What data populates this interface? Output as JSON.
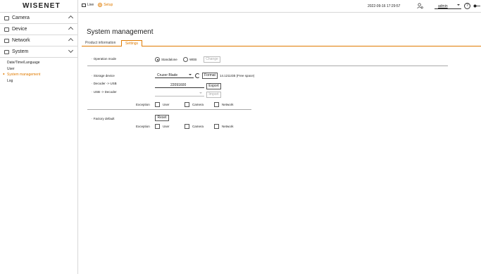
{
  "app": {
    "logo": "WISENET",
    "nav": {
      "live": "Live",
      "setup": "Setup"
    },
    "datetime": "2022-09-16 17:29:57",
    "user": "admin",
    "help": "?"
  },
  "sidebar": {
    "sections": [
      {
        "label": "Camera"
      },
      {
        "label": "Device"
      },
      {
        "label": "Network"
      },
      {
        "label": "System"
      }
    ],
    "system_items": [
      {
        "label": "Date/Time/Language"
      },
      {
        "label": "User"
      },
      {
        "label": "System management"
      },
      {
        "label": "Log"
      }
    ]
  },
  "main": {
    "title": "System management",
    "tabs": {
      "product": "Product information",
      "settings": "Settings"
    },
    "operation_mode": {
      "label": "Operation mode",
      "option1": "Standalone",
      "option2": "WEB",
      "change": "Change",
      "selected": "Standalone"
    },
    "storage": {
      "label": "Storage device",
      "device": "Cruzer Blade",
      "format": "Format",
      "free": "14.1211GB (Free space)"
    },
    "decoder_usb": {
      "label": "Decoder -> USB",
      "value": "22091600",
      "export": "Export"
    },
    "usb_decoder": {
      "label": "USB -> Decoder",
      "import": "Import"
    },
    "exception": {
      "label": "Exception",
      "user": "User",
      "camera": "Camera",
      "network": "Network"
    },
    "factory": {
      "label": "Factory default",
      "reset": "Reset"
    }
  }
}
